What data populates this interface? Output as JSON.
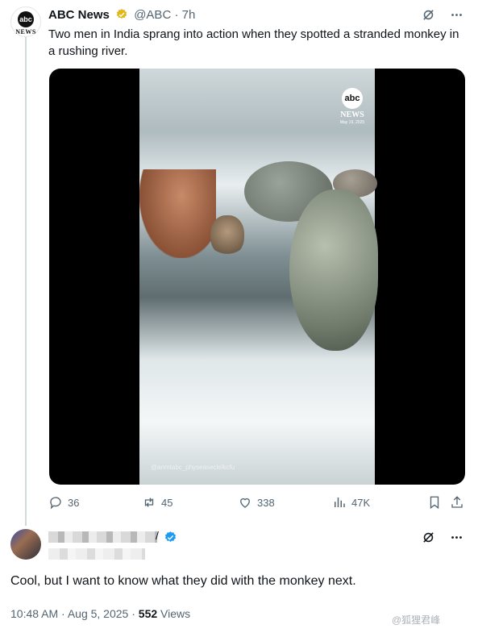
{
  "tweet": {
    "author_name": "ABC News",
    "avatar_text": "abc",
    "avatar_subtext": "NEWS",
    "handle": "@ABC",
    "separator": "·",
    "time_ago": "7h",
    "text": "Two men in India sprang into action when they spotted a stranded monkey in a rushing river.",
    "media": {
      "logo_text": "abc",
      "logo_subtext": "NEWS",
      "date_overlay": "May 19, 2025",
      "credit_overlay": "@anmtabc_physeaseclelkcfu"
    },
    "actions": {
      "replies": "36",
      "reposts": "45",
      "likes": "338",
      "views": "47K"
    }
  },
  "reply": {
    "name_suffix": "/",
    "text": "Cool, but I want to know what they did with the monkey next.",
    "timestamp": "10:48 AM · Aug 5, 2025 · ",
    "views_count": "552",
    "views_label": " Views"
  },
  "watermark": "@狐狸君峰",
  "colors": {
    "verified_gold": "#e2b719",
    "verified_blue": "#1d9bf0",
    "muted_text": "#536471"
  },
  "icons": [
    "grok-icon",
    "more-icon",
    "reply-icon",
    "repost-icon",
    "like-icon",
    "views-icon",
    "bookmark-icon",
    "share-icon",
    "verified-badge-icon"
  ]
}
